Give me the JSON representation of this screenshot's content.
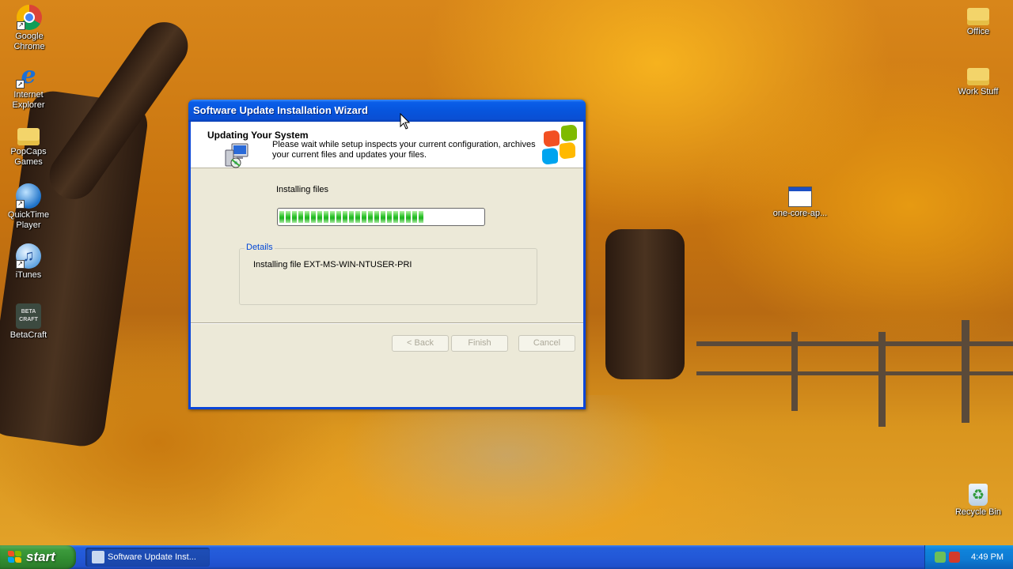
{
  "desktop": {
    "icons_left": [
      {
        "label": "Google Chrome",
        "icon": "chrome-icon"
      },
      {
        "label": "Internet Explorer",
        "icon": "internet-explorer-icon"
      },
      {
        "label": "PopCaps Games",
        "icon": "folder-icon"
      },
      {
        "label": "QuickTime Player",
        "icon": "quicktime-icon"
      },
      {
        "label": "iTunes",
        "icon": "itunes-icon"
      },
      {
        "label": "BetaCraft",
        "icon": "betacraft-icon"
      }
    ],
    "icons_right": [
      {
        "label": "Office",
        "icon": "folder-icon"
      },
      {
        "label": "Work Stuff",
        "icon": "folder-icon"
      },
      {
        "label": "one-core-ap...",
        "icon": "application-icon"
      },
      {
        "label": "Recycle Bin",
        "icon": "recycle-bin-icon"
      }
    ],
    "betacraft_glyph": "BETA CRAFT",
    "itunes_glyph": "♫",
    "ie_glyph": "e",
    "recycle_glyph": "♻",
    "shortcut_glyph": "↗"
  },
  "window": {
    "title": "Software Update Installation Wizard",
    "header_title": "Updating Your System",
    "message": "Please wait while setup inspects your current configuration, archives your current files and updates your files.",
    "status_label": "Installing files",
    "progress": 0.71,
    "details_legend": "Details",
    "details_text": "Installing file EXT-MS-WIN-NTUSER-PRI",
    "buttons": {
      "back": "< Back",
      "finish": "Finish",
      "cancel": "Cancel"
    },
    "progress_color": "#2fc42f",
    "legend_color": "#0046d5"
  },
  "taskbar": {
    "start_label": "start",
    "task_button_label": "Software Update Inst...",
    "clock": "4:49 PM"
  }
}
